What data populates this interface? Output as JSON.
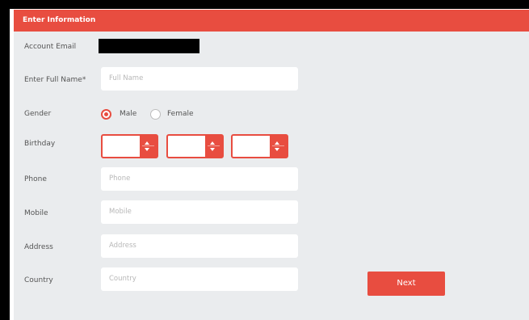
{
  "header": {
    "title": "Enter Information"
  },
  "form": {
    "account_email_label": "Account Email",
    "full_name_label": "Enter Full Name*",
    "full_name_placeholder": "Full Name",
    "gender_label": "Gender",
    "gender_options": [
      "Male",
      "Female"
    ],
    "gender_selected": "Male",
    "birthday_label": "Birthday",
    "phone_label": "Phone",
    "phone_placeholder": "Phone",
    "mobile_label": "Mobile",
    "mobile_placeholder": "Mobile",
    "address_label": "Address",
    "address_placeholder": "Address",
    "country_label": "Country",
    "country_placeholder": "Country",
    "next_label": "Next"
  },
  "colors": {
    "accent": "#e84d40",
    "panel_bg": "#eaecee"
  },
  "icons": [
    "chevron-up-icon",
    "chevron-down-icon"
  ]
}
